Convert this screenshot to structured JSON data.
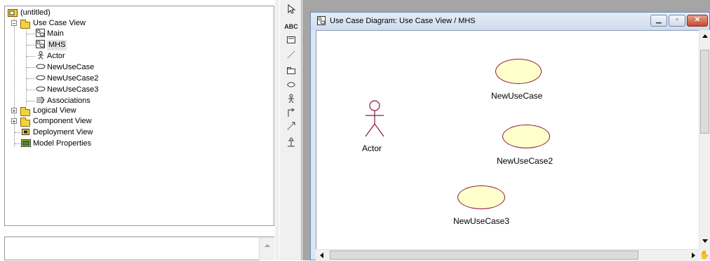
{
  "browser": {
    "root_label": "(untitled)",
    "items": [
      {
        "label": "Use Case View",
        "expander": "−"
      },
      {
        "label": "Main"
      },
      {
        "label": "MHS"
      },
      {
        "label": "Actor"
      },
      {
        "label": "NewUseCase"
      },
      {
        "label": "NewUseCase2"
      },
      {
        "label": "NewUseCase3"
      },
      {
        "label": "Associations"
      },
      {
        "label": "Logical View",
        "expander": "+"
      },
      {
        "label": "Component View",
        "expander": "+"
      },
      {
        "label": "Deployment View"
      },
      {
        "label": "Model Properties"
      }
    ]
  },
  "toolbar": {
    "text_tool": "ABC"
  },
  "diagram_window": {
    "title": "Use Case Diagram: Use Case View / MHS",
    "actor_label": "Actor",
    "use_cases": [
      "NewUseCase",
      "NewUseCase2",
      "NewUseCase3"
    ]
  },
  "colors": {
    "usecase_fill": "#ffffcc",
    "usecase_stroke": "#8a1a3a",
    "actor_stroke": "#8a1a3a",
    "folder": "#f4d23a"
  }
}
